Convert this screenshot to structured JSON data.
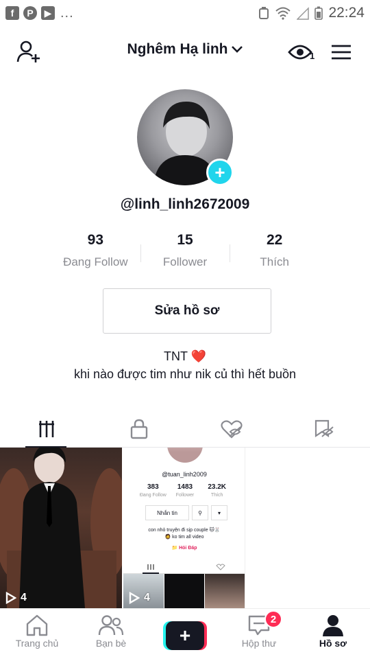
{
  "status_bar": {
    "notification_icons": [
      "facebook-icon",
      "pinterest-icon",
      "youtube-icon"
    ],
    "more": "...",
    "time": "22:24"
  },
  "header": {
    "title": "Nghêm Hạ linh",
    "viewer_count": "1"
  },
  "profile": {
    "username": "@linh_linh2672009",
    "stats": [
      {
        "value": "93",
        "label": "Đang Follow"
      },
      {
        "value": "15",
        "label": "Follower"
      },
      {
        "value": "22",
        "label": "Thích"
      }
    ],
    "edit_label": "Sửa hồ sơ",
    "bio_line1": "TNT ❤️",
    "bio_line2": "khi nào được tim như nik củ thì hết buồn"
  },
  "tabs": [
    "videos-grid-icon",
    "lock-icon",
    "liked-hidden-icon",
    "saved-hidden-icon"
  ],
  "videos": [
    {
      "views": "4"
    },
    {
      "views": "4",
      "embedded": {
        "username": "@tuan_linh2009",
        "stats": [
          {
            "value": "383",
            "label": "Đang Follow"
          },
          {
            "value": "1483",
            "label": "Follower"
          },
          {
            "value": "23.2K",
            "label": "Thích"
          }
        ],
        "message_label": "Nhắn tin",
        "bio_line1": "con nhỏ truyện đi sịp couple 🐱🐰",
        "bio_line2": "🧔 ko tim all video",
        "qa_label": "📁 Hỏi Đáp"
      }
    }
  ],
  "bottom_nav": {
    "home": "Trang chủ",
    "friends": "Bạn bè",
    "create": "+",
    "inbox": "Hộp thư",
    "inbox_badge": "2",
    "profile": "Hồ sơ"
  },
  "colors": {
    "accent_cyan": "#20d5ec",
    "accent_red": "#fe2c55",
    "text_primary": "#161823",
    "text_secondary": "#8a8b91"
  }
}
